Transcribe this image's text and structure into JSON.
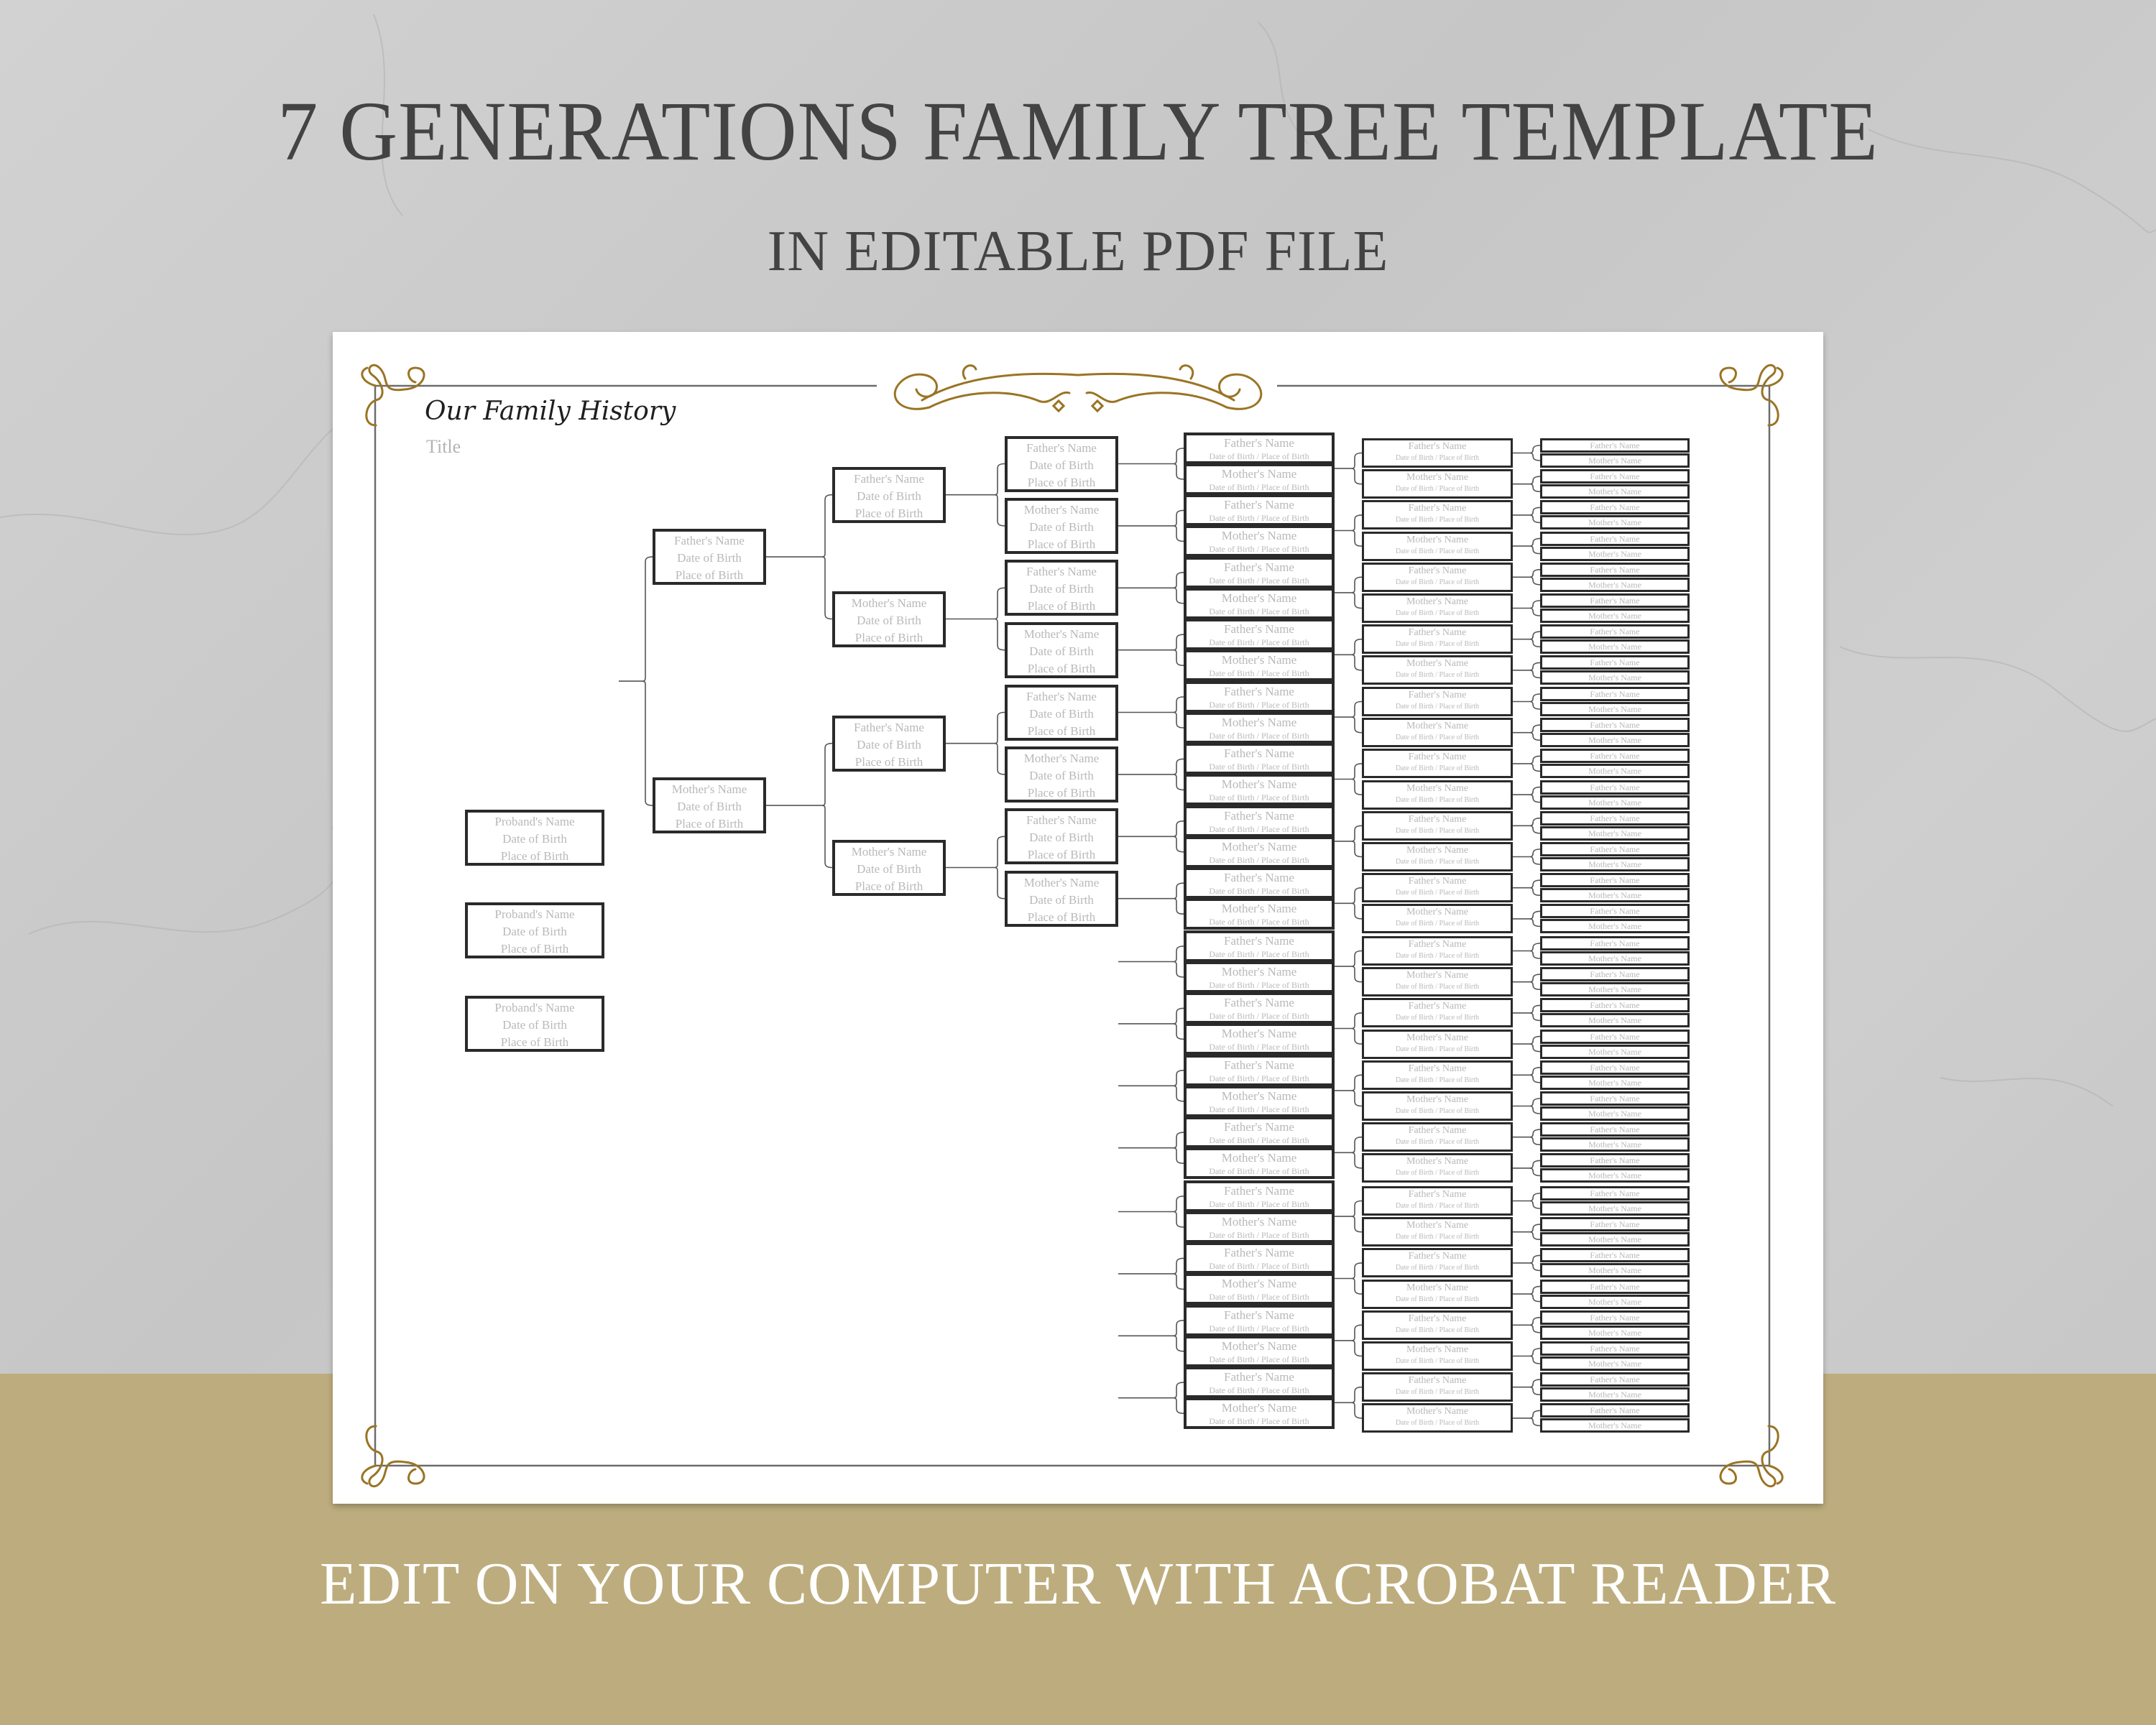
{
  "headline": {
    "title": "7 GENERATIONS FAMILY TREE TEMPLATE",
    "subtitle": "IN EDITABLE PDF FILE",
    "footer": "EDIT ON YOUR COMPUTER WITH ACROBAT READER"
  },
  "colors": {
    "gold_band": "#bdad7e",
    "ornament_gold": "#9a7424",
    "headline_text": "#434343",
    "footer_text": "#ffffff",
    "placeholder_text": "#b9b9b9",
    "box_border": "#2a2a2a"
  },
  "document": {
    "script_title": "Our Family History",
    "title_placeholder": "Title",
    "ornaments": [
      "corner-flourish-top-left",
      "header-scroll-ornament",
      "corner-flourish-top-right",
      "corner-flourish-bottom-left",
      "corner-flourish-bottom-right"
    ]
  },
  "tree": {
    "generations": 7,
    "proband": {
      "count": 3,
      "lines": [
        "Proband's Name",
        "Date of Birth",
        "Place of Birth"
      ]
    },
    "father_full": [
      "Father's Name",
      "Date of Birth",
      "Place of Birth"
    ],
    "mother_full": [
      "Mother's Name",
      "Date of Birth",
      "Place of Birth"
    ],
    "father_compact": [
      "Father's Name",
      "Date of Birth / Place of Birth"
    ],
    "mother_compact": [
      "Mother's Name",
      "Date of Birth / Place of Birth"
    ],
    "father_name_only": "Father's Name",
    "mother_name_only": "Mother's Name",
    "counts": {
      "gen2": 2,
      "gen3": 4,
      "gen4": 8,
      "gen5": 16,
      "gen6": 32,
      "gen7": 64
    }
  }
}
